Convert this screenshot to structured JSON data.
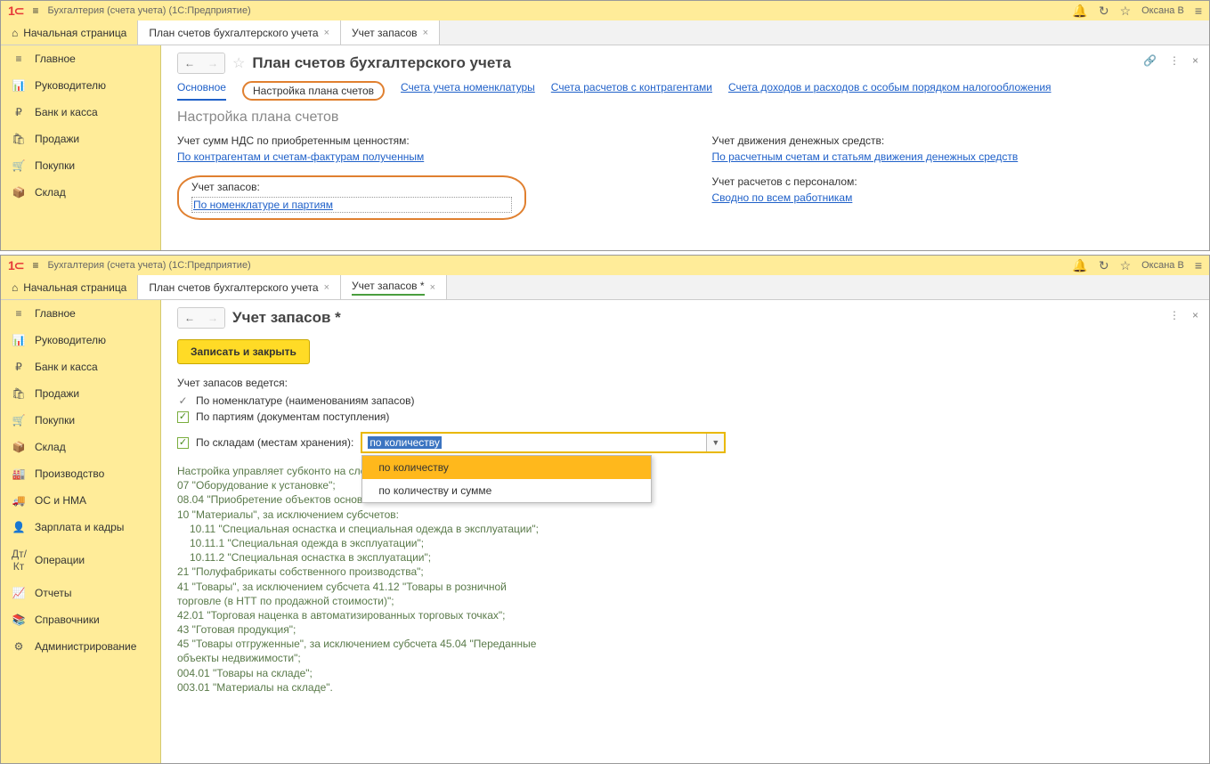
{
  "topWindow": {
    "titleBar": {
      "appName": "Бухгалтерия (счета учета)  (1С:Предприятие)",
      "userName": "Оксана В"
    },
    "tabs": {
      "home": "Начальная страница",
      "t1": "План счетов бухгалтерского учета",
      "t2": "Учет запасов"
    },
    "sidebar": {
      "items": [
        "Главное",
        "Руководителю",
        "Банк и касса",
        "Продажи",
        "Покупки",
        "Склад"
      ]
    },
    "content": {
      "pageTitle": "План счетов бухгалтерского учета",
      "subtabs": {
        "main": "Основное",
        "settings": "Настройка плана счетов",
        "nomen": "Счета учета номенклатуры",
        "contr": "Счета расчетов с контрагентами",
        "income": "Счета доходов и расходов с особым порядком налогообложения"
      },
      "sectionTitle": "Настройка плана счетов",
      "col1": {
        "block1Label": "Учет сумм НДС по приобретенным ценностям:",
        "block1Link": "По контрагентам и счетам-фактурам полученным",
        "block2Label": "Учет запасов:",
        "block2Link": "По номенклатуре и партиям"
      },
      "col2": {
        "block1Label": "Учет движения денежных средств:",
        "block1Link": "По расчетным счетам и статьям движения денежных средств",
        "block2Label": "Учет расчетов с персоналом:",
        "block2Link": "Сводно по всем работникам"
      }
    }
  },
  "bottomWindow": {
    "titleBar": {
      "appName": "Бухгалтерия (счета учета)  (1С:Предприятие)",
      "userName": "Оксана В"
    },
    "tabs": {
      "home": "Начальная страница",
      "t1": "План счетов бухгалтерского учета",
      "t2": "Учет запасов *"
    },
    "sidebar": {
      "items": [
        "Главное",
        "Руководителю",
        "Банк и касса",
        "Продажи",
        "Покупки",
        "Склад",
        "Производство",
        "ОС и НМА",
        "Зарплата и кадры",
        "Операции",
        "Отчеты",
        "Справочники",
        "Администрирование"
      ]
    },
    "content": {
      "pageTitle": "Учет запасов *",
      "saveBtn": "Записать и закрыть",
      "introLabel": "Учет запасов ведется:",
      "row1": "По номенклатуре (наименованиям запасов)",
      "row2": "По партиям (документам поступления)",
      "row3": "По складам (местам хранения):",
      "comboValue": "по количеству",
      "dd1": "по количеству",
      "dd2": "по количеству и сумме",
      "info": {
        "l0": "Настройка управляет субконто на сле",
        "l1": "07 \"Оборудование к установке\";",
        "l2": "08.04 \"Приобретение объектов основн",
        "l3": "10 \"Материалы\", за исключением субсчетов:",
        "l4": "10.11 \"Специальная оснастка и специальная одежда в эксплуатации\";",
        "l5": "10.11.1 \"Специальная одежда в эксплуатации\";",
        "l6": "10.11.2 \"Специальная оснастка в эксплуатации\";",
        "l7": "21 \"Полуфабрикаты собственного производства\";",
        "l8": "41 \"Товары\", за исключением субсчета 41.12 \"Товары в розничной торговле (в НТТ по продажной стоимости)\";",
        "l9": "42.01 \"Торговая наценка в автоматизированных торговых точках\";",
        "l10": "43 \"Готовая продукция\";",
        "l11": "45 \"Товары отгруженные\", за исключением субсчета 45.04 \"Переданные объекты недвижимости\";",
        "l12": "004.01 \"Товары на складе\";",
        "l13": "003.01 \"Материалы на складе\"."
      }
    }
  }
}
